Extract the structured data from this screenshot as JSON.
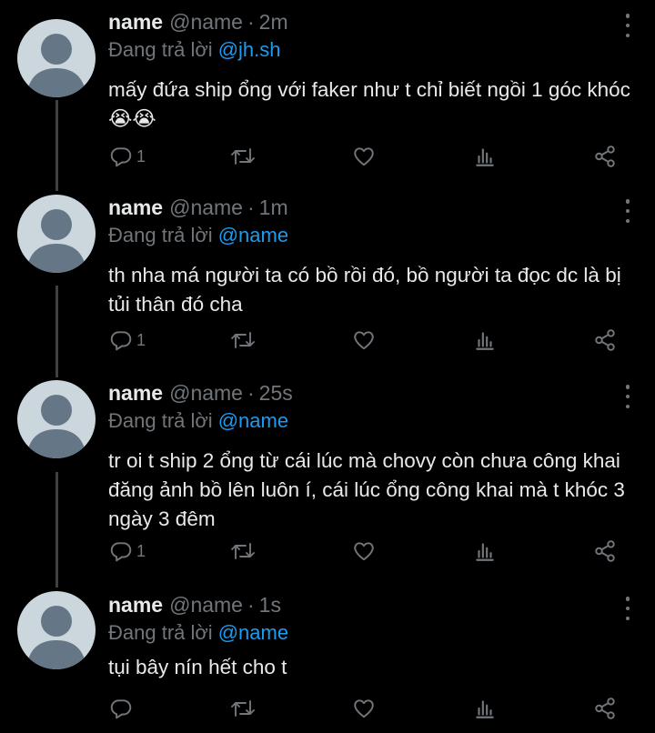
{
  "thread": {
    "tweets": [
      {
        "name": "name",
        "handle": "@name",
        "separator": "·",
        "time": "2m",
        "reply_prefix": "Đang trả lời",
        "reply_to": "@jh.sh",
        "text": "mấy đứa ship ổng với faker như t chỉ biết ngồi 1 góc khóc😭😭",
        "reply_count": "1"
      },
      {
        "name": "name",
        "handle": "@name",
        "separator": "·",
        "time": "1m",
        "reply_prefix": "Đang trả lời",
        "reply_to": "@name",
        "text": "th nha má người ta có bồ rồi đó, bồ người ta đọc dc là bị tủi thân đó cha",
        "reply_count": "1"
      },
      {
        "name": "name",
        "handle": "@name",
        "separator": "·",
        "time": "25s",
        "reply_prefix": "Đang trả lời",
        "reply_to": "@name",
        "text": "tr oi t ship 2 ổng từ cái lúc mà chovy còn chưa công khai đăng ảnh bồ lên luôn í, cái lúc ổng công khai mà t khóc 3 ngày 3 đêm",
        "reply_count": "1"
      },
      {
        "name": "name",
        "handle": "@name",
        "separator": "·",
        "time": "1s",
        "reply_prefix": "Đang trả lời",
        "reply_to": "@name",
        "text": "tụi bây nín hết cho t",
        "reply_count": ""
      }
    ]
  },
  "colors": {
    "background": "#000000",
    "text_primary": "#e7e9ea",
    "text_secondary": "#71767b",
    "mention": "#1d9bf0",
    "avatar_bg": "#ccd6dd",
    "avatar_fg": "#657786",
    "thread_line": "#3e4144"
  },
  "icons": [
    "more-icon",
    "reply-icon",
    "retweet-icon",
    "like-icon",
    "analytics-icon",
    "share-icon"
  ]
}
